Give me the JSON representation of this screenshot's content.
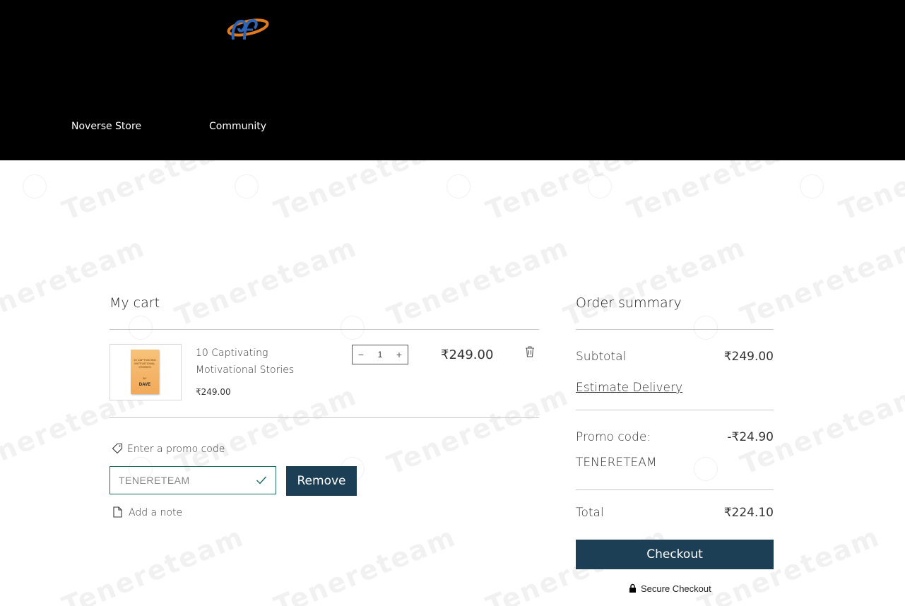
{
  "nav": {
    "logo": "logo",
    "items": [
      {
        "label": "Noverse Store"
      },
      {
        "label": "Community"
      }
    ]
  },
  "watermark": "Tenereteam",
  "cart": {
    "title": "My cart",
    "item": {
      "name": "10 Captivating Motivational Stories",
      "unit_price": "₹249.00",
      "quantity": "1",
      "decrement": "−",
      "increment": "+",
      "line_total": "₹249.00",
      "book_cover_title": "10 CAPTIVATING MOTIVATIONAL STORIES",
      "book_cover_by": "BY",
      "book_cover_author": "DAVE"
    },
    "promo_label": "Enter a promo code",
    "promo_value": "TENERETEAM",
    "remove_label": "Remove",
    "note_label": "Add a note"
  },
  "summary": {
    "title": "Order summary",
    "subtotal_label": "Subtotal",
    "subtotal_value": "₹249.00",
    "estimate_delivery": "Estimate Delivery",
    "promo_label": "Promo code:",
    "promo_value": "-₹24.90",
    "promo_code": "TENERETEAM",
    "total_label": "Total",
    "total_value": "₹224.10",
    "checkout_label": "Checkout",
    "secure_label": "Secure Checkout"
  },
  "colors": {
    "header_bg": "#000000",
    "button_bg": "#1c3f55",
    "input_border": "#1d6b5f",
    "check_color": "#1d6b5f"
  }
}
